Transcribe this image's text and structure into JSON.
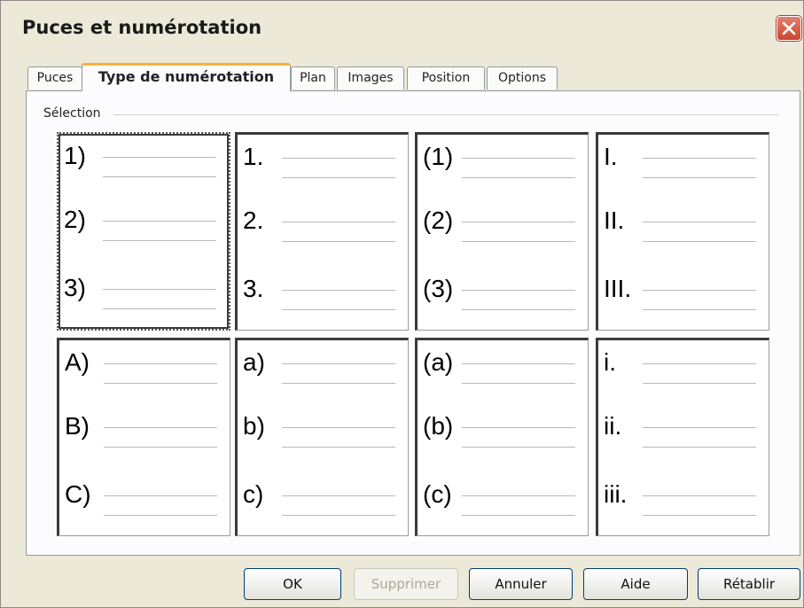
{
  "window": {
    "title": "Puces et numérotation",
    "close_icon": "close-icon"
  },
  "tabs": [
    {
      "label": "Puces",
      "active": false
    },
    {
      "label": "Type de numérotation",
      "active": true
    },
    {
      "label": "Plan",
      "active": false
    },
    {
      "label": "Images",
      "active": false
    },
    {
      "label": "Position",
      "active": false
    },
    {
      "label": "Options",
      "active": false
    }
  ],
  "selection": {
    "label": "Sélection",
    "styles": [
      {
        "items": [
          "1)",
          "2)",
          "3)"
        ],
        "selected": true
      },
      {
        "items": [
          "1.",
          "2.",
          "3."
        ],
        "selected": false
      },
      {
        "items": [
          "(1)",
          "(2)",
          "(3)"
        ],
        "selected": false
      },
      {
        "items": [
          "I.",
          "II.",
          "III."
        ],
        "selected": false
      },
      {
        "items": [
          "A)",
          "B)",
          "C)"
        ],
        "selected": false
      },
      {
        "items": [
          "a)",
          "b)",
          "c)"
        ],
        "selected": false
      },
      {
        "items": [
          "(a)",
          "(b)",
          "(c)"
        ],
        "selected": false
      },
      {
        "items": [
          "i.",
          "ii.",
          "iii."
        ],
        "selected": false
      }
    ]
  },
  "buttons": {
    "ok": "OK",
    "delete": "Supprimer",
    "cancel": "Annuler",
    "help": "Aide",
    "reset": "Rétablir"
  },
  "colors": {
    "accent_tab": "#f7b33b",
    "close_red": "#c94731",
    "dialog_bg": "#ece9d8"
  }
}
